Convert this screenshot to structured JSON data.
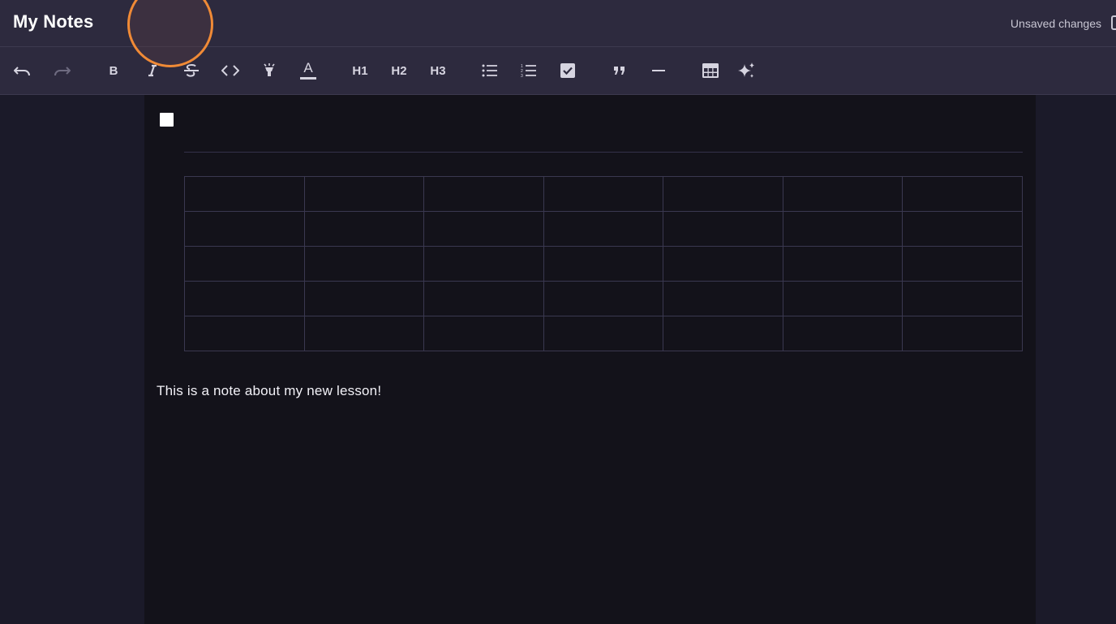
{
  "header": {
    "title": "My Notes",
    "status": "Unsaved changes",
    "save_icon": "save-icon"
  },
  "toolbar": {
    "undo_icon": "undo-icon",
    "redo_icon": "redo-icon",
    "bold_label": "B",
    "italic_icon": "italic-icon",
    "strike_icon": "strikethrough-icon",
    "code_icon": "code-icon",
    "highlight_icon": "highlighter-icon",
    "textcolor_label": "A",
    "h1_label": "H1",
    "h2_label": "H2",
    "h3_label": "H3",
    "bullet_icon": "bulleted-list-icon",
    "ordered_icon": "numbered-list-icon",
    "task_icon": "task-list-icon",
    "quote_icon": "blockquote-icon",
    "hr_icon": "horizontal-rule-icon",
    "table_icon": "table-icon",
    "ai_icon": "sparkles-icon"
  },
  "editor": {
    "task_checked": false,
    "table": {
      "rows": 5,
      "cols": 7,
      "cells": [
        [
          "",
          "",
          "",
          "",
          "",
          "",
          ""
        ],
        [
          "",
          "",
          "",
          "",
          "",
          "",
          ""
        ],
        [
          "",
          "",
          "",
          "",
          "",
          "",
          ""
        ],
        [
          "",
          "",
          "",
          "",
          "",
          "",
          ""
        ],
        [
          "",
          "",
          "",
          "",
          "",
          "",
          ""
        ]
      ]
    },
    "paragraph": "This is a note about my new lesson!"
  },
  "colors": {
    "accent_ring": "#f08a36",
    "header_bg": "#2d2a3e",
    "editor_bg": "#13121a"
  }
}
